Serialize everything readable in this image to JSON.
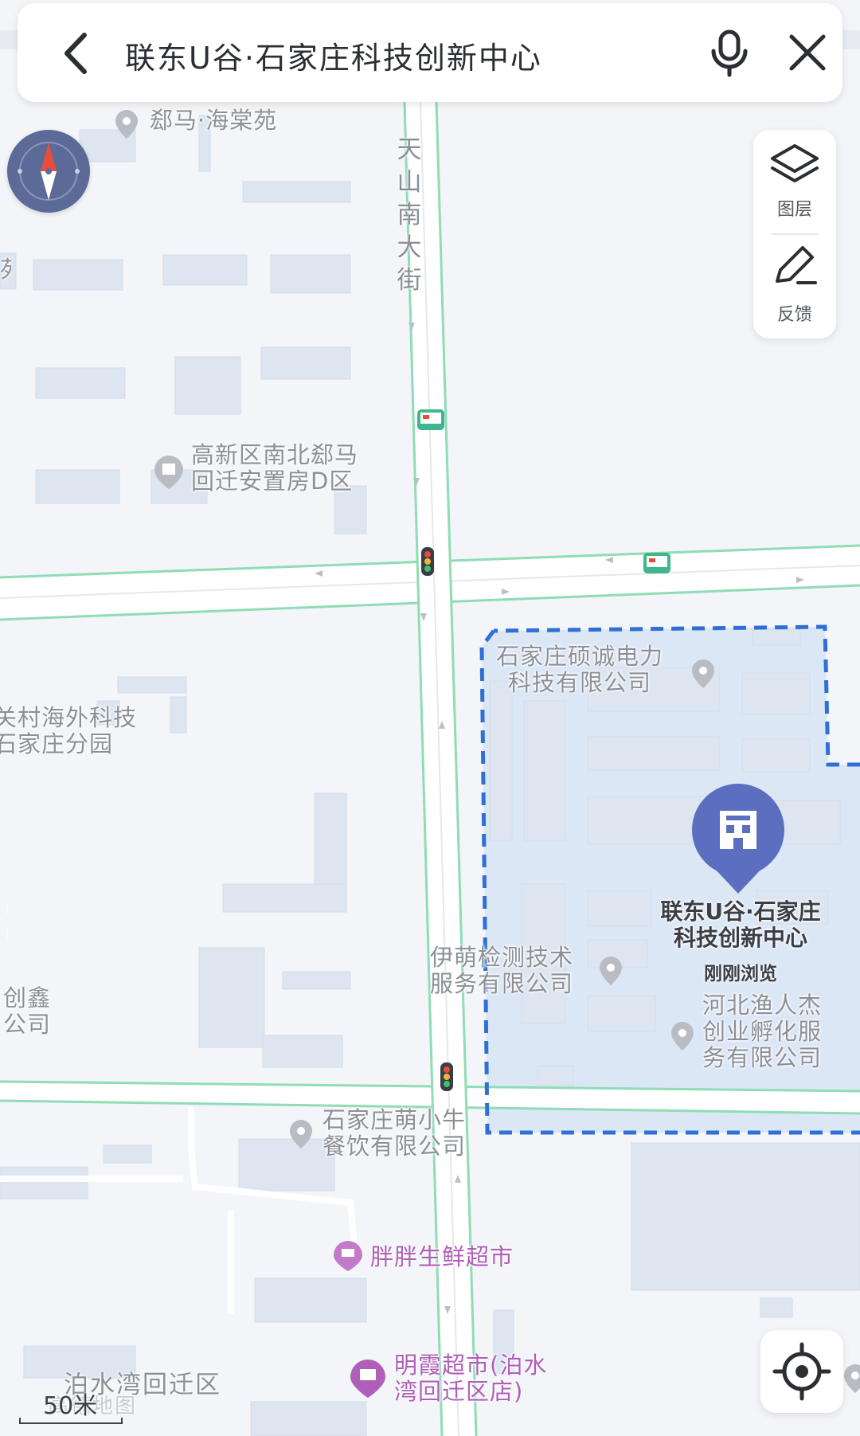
{
  "search": {
    "query": "联东U谷·石家庄科技创新中心",
    "back_icon": "back-chevron-icon",
    "mic_icon": "microphone-icon",
    "close_icon": "close-icon"
  },
  "map_controls": {
    "compass_icon": "compass-icon",
    "layers_label": "图层",
    "feedback_label": "反馈",
    "locate_icon": "locate-crosshair-icon"
  },
  "scale": {
    "label": "50米"
  },
  "roads": {
    "tianshan": "天\n山\n南\n大\n街"
  },
  "pois": {
    "haitangyuan": "郄马·海棠苑",
    "gaoxin_d": "高新区南北郄马\n回迁安置房D区",
    "zhongguancun": "关村海外科技\n石家庄分园",
    "shuocheng": "石家庄硕诚电力\n科技有限公司",
    "yimeng": "伊萌检测技术\n服务有限公司",
    "yurenjie": "河北渔人杰\n创业孵化服\n务有限公司",
    "mengxiaoniu": "石家庄萌小牛\n餐饮有限公司",
    "chuangxin": "创鑫\n公司",
    "edge_left": "刂\n刂",
    "pangpang": "胖胖生鲜超市",
    "mingxia": "明霞超市(泊水\n湾回迁区店)",
    "poshuiwan": "泊水湾回迁区",
    "edge_top_left": "苑"
  },
  "selected": {
    "name": "联东U谷·石家庄\n科技创新中心",
    "badge": "刚刚浏览",
    "pin_icon": "building-pin-icon"
  },
  "colors": {
    "map_bg": "#f3f5f8",
    "road_edge": "#8fdcb5",
    "building": "#dde6f0",
    "boundary": "#2f6fd6",
    "selected_fill": "#dce7f6",
    "pin": "#5b6ebf",
    "shop_pin": "#b05fb8"
  },
  "watermark": "高德地图"
}
